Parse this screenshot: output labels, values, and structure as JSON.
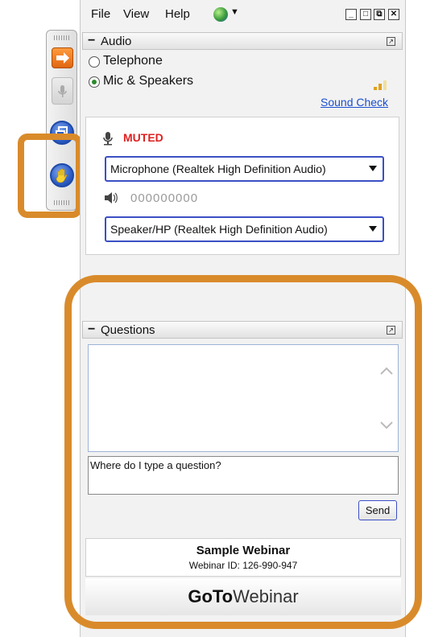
{
  "menu": {
    "file": "File",
    "view": "View",
    "help": "Help"
  },
  "audio": {
    "title": "Audio",
    "options": [
      {
        "label": "Telephone",
        "selected": false
      },
      {
        "label": "Mic & Speakers",
        "selected": true
      }
    ],
    "sound_check": "Sound Check",
    "mic_status": "MUTED",
    "microphone_select": "Microphone (Realtek High Definition Audio)",
    "speaker_level": "000000000",
    "speaker_select": "Speaker/HP (Realtek High Definition Audio)"
  },
  "questions": {
    "title": "Questions",
    "input_value": "Where do I type a question?",
    "send_label": "Send"
  },
  "webinar": {
    "name": "Sample Webinar",
    "id_text": "Webinar ID: 126-990-947",
    "brand_bold": "GoTo",
    "brand_light": "Webinar"
  },
  "colors": {
    "highlight": "#d98b2b",
    "muted": "#e02020",
    "link": "#1a4fd0"
  }
}
